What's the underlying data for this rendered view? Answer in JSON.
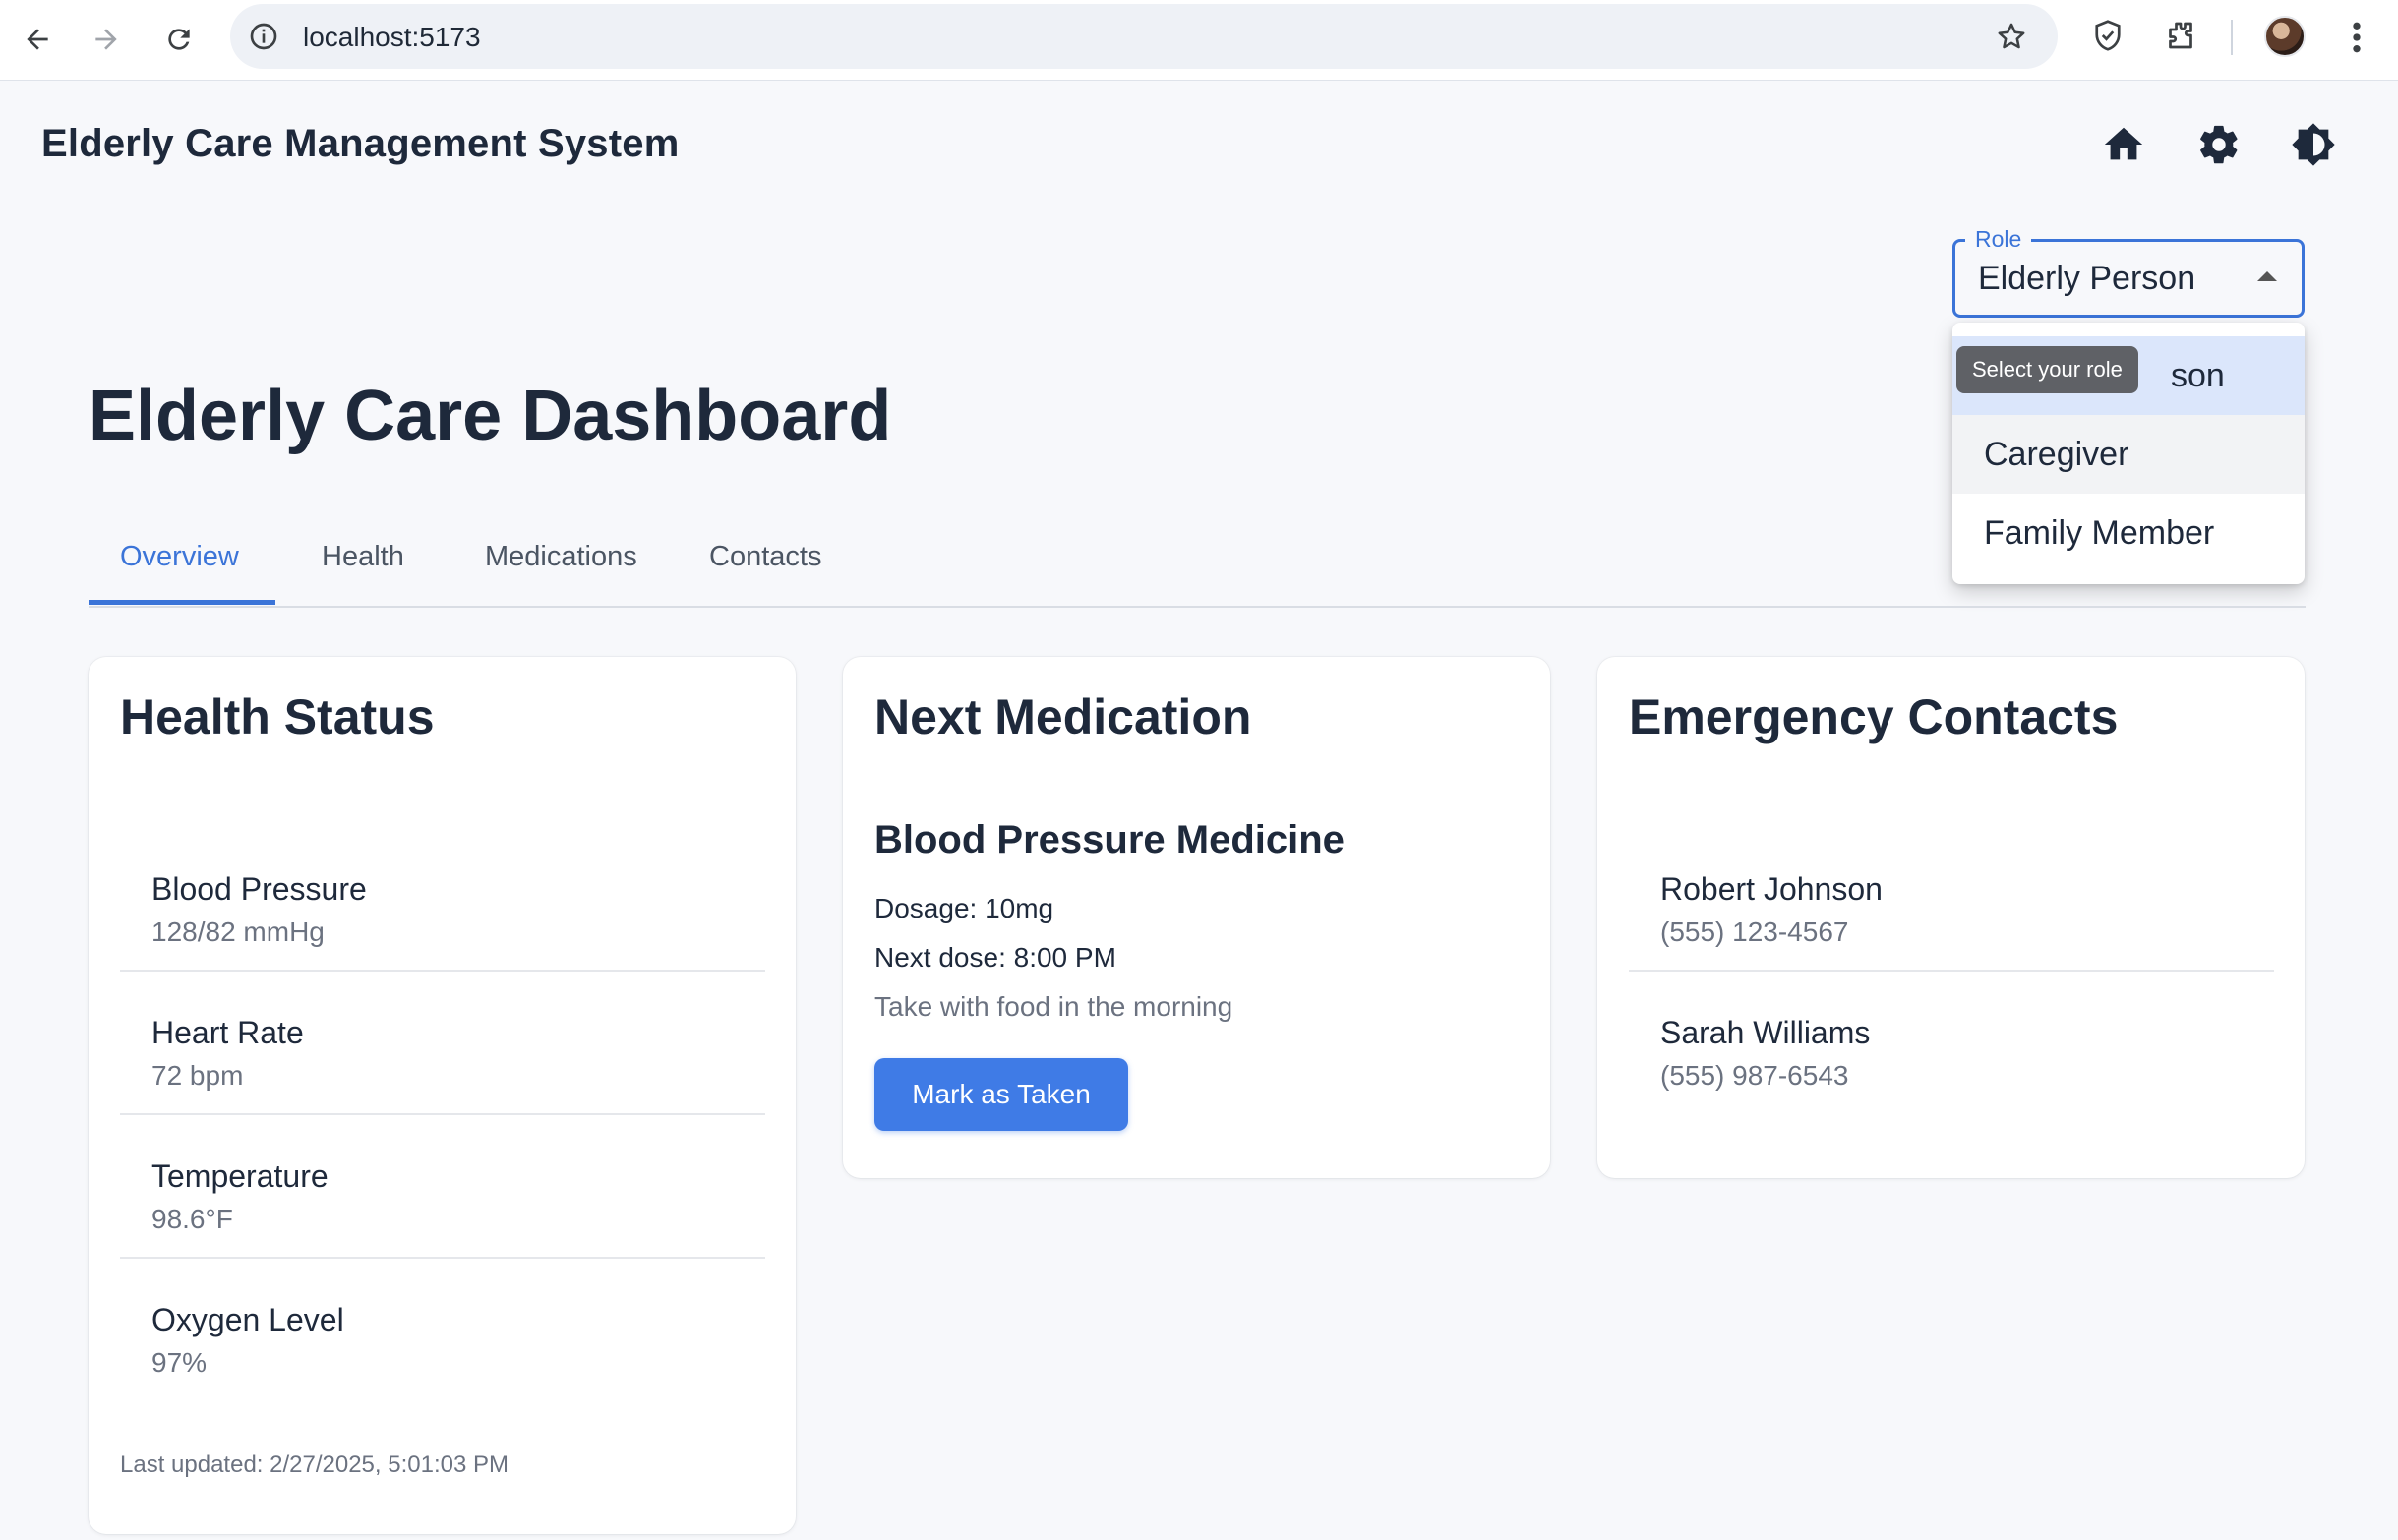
{
  "browser": {
    "url": "localhost:5173"
  },
  "app": {
    "title": "Elderly Care Management System",
    "icons": [
      "home-icon",
      "settings-icon",
      "theme-toggle-icon"
    ]
  },
  "role_select": {
    "legend": "Role",
    "value": "Elderly Person",
    "tooltip": "Select your role",
    "options": [
      "Elderly Person",
      "Caregiver",
      "Family Member"
    ],
    "visible_first_option_fragment": "son"
  },
  "dashboard": {
    "title": "Elderly Care Dashboard",
    "tabs": [
      "Overview",
      "Health",
      "Medications",
      "Contacts"
    ],
    "active_tab": "Overview"
  },
  "health_status": {
    "title": "Health Status",
    "items": [
      {
        "label": "Blood Pressure",
        "value": "128/82 mmHg"
      },
      {
        "label": "Heart Rate",
        "value": "72 bpm"
      },
      {
        "label": "Temperature",
        "value": "98.6°F"
      },
      {
        "label": "Oxygen Level",
        "value": "97%"
      }
    ],
    "last_updated": "Last updated: 2/27/2025, 5:01:03 PM"
  },
  "next_medication": {
    "title": "Next Medication",
    "name": "Blood Pressure Medicine",
    "dosage": "Dosage: 10mg",
    "next_dose": "Next dose: 8:00 PM",
    "note": "Take with food in the morning",
    "button": "Mark as Taken"
  },
  "emergency_contacts": {
    "title": "Emergency Contacts",
    "contacts": [
      {
        "name": "Robert Johnson",
        "phone": "(555) 123-4567"
      },
      {
        "name": "Sarah Williams",
        "phone": "(555) 987-6543"
      }
    ]
  },
  "colors": {
    "accent": "#3b74d8",
    "button": "#3f7be6",
    "text": "#1e293b",
    "muted": "#6b7280",
    "background": "#f7f8fb"
  }
}
